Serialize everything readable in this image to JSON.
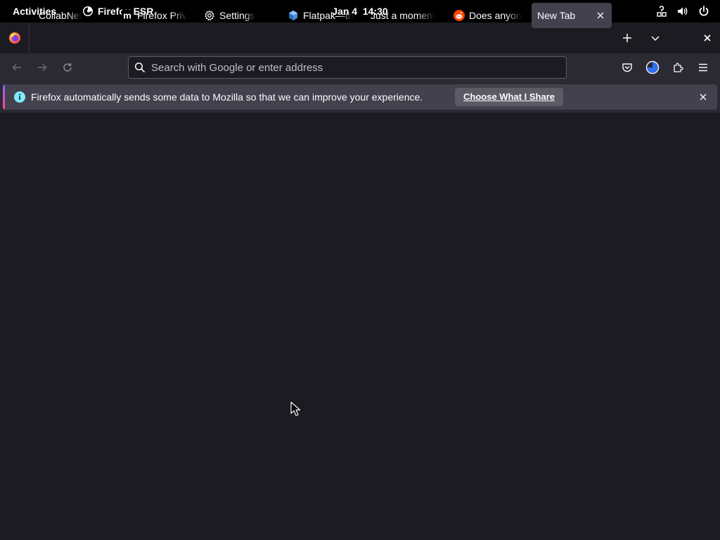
{
  "shell": {
    "activities": "Activities",
    "app_name": "Firefox ESR",
    "date": "Jan 4",
    "time": "14:30",
    "tray_icons": [
      "network-unknown-icon",
      "volume-icon",
      "power-icon"
    ]
  },
  "tabs": [
    {
      "title": "CollabNet",
      "favicon": "none",
      "selected": false
    },
    {
      "title": "Firefox Priv",
      "favicon": "m-logo-icon",
      "selected": false
    },
    {
      "title": "Settings",
      "favicon": "gear-icon",
      "selected": false
    },
    {
      "title": "Flatpak—th",
      "favicon": "flatpak-cube-icon",
      "selected": false
    },
    {
      "title": "Just a moment",
      "favicon": "none",
      "selected": false
    },
    {
      "title": "Does anyon",
      "favicon": "reddit-icon",
      "selected": false
    },
    {
      "title": "New Tab",
      "favicon": "none",
      "selected": true
    }
  ],
  "urlbar": {
    "placeholder": "Search with Google or enter address",
    "value": ""
  },
  "notification": {
    "message": "Firefox automatically sends some data to Mozilla so that we can improve your experience.",
    "button_label": "Choose What I Share"
  },
  "colors": {
    "chrome_bg": "#1c1b22",
    "toolbar_bg": "#2b2a33",
    "selected_tab_bg": "#42414d",
    "notification_bg": "#42414d",
    "info_icon": "#80ebff",
    "accent_gradient": [
      "#9059ff",
      "#ff4aa2"
    ]
  }
}
